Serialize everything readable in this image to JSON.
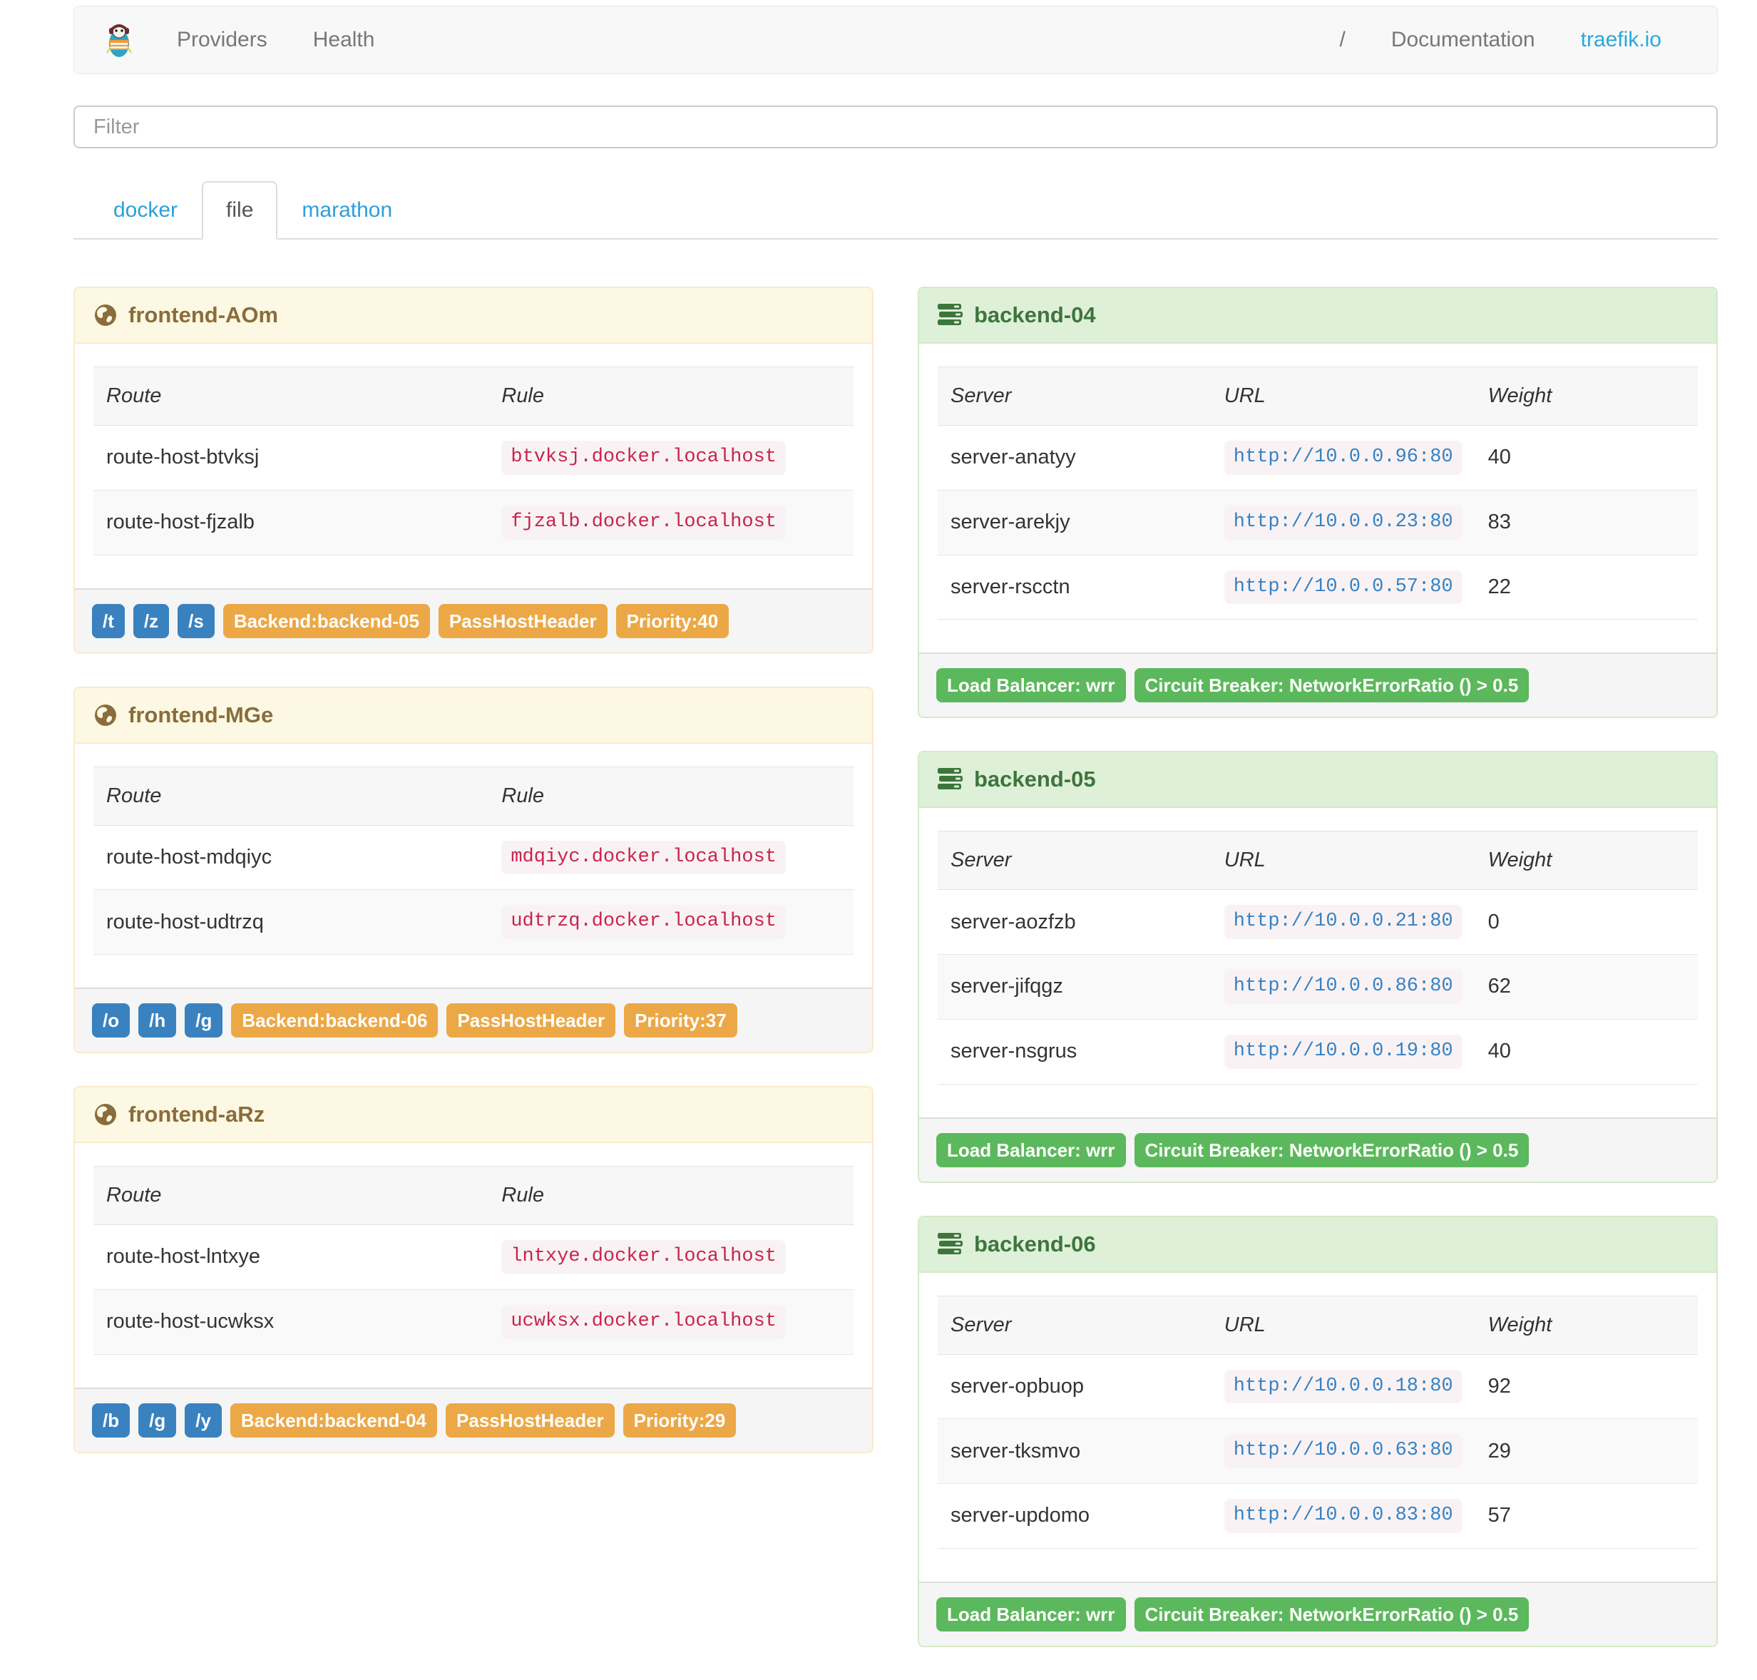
{
  "navbar": {
    "providers": "Providers",
    "health": "Health",
    "separator": "/",
    "documentation": "Documentation",
    "site_link": "traefik.io"
  },
  "filter": {
    "placeholder": "Filter"
  },
  "tabs": {
    "docker": "docker",
    "file": "file",
    "marathon": "marathon"
  },
  "labels": {
    "route": "Route",
    "rule": "Rule",
    "server": "Server",
    "url": "URL",
    "weight": "Weight"
  },
  "frontends": [
    {
      "title": "frontend-AOm",
      "routes": [
        {
          "route": "route-host-btvksj",
          "rule": "btvksj.docker.localhost"
        },
        {
          "route": "route-host-fjzalb",
          "rule": "fjzalb.docker.localhost"
        }
      ],
      "paths": [
        "/t",
        "/z",
        "/s"
      ],
      "backend_badge": "Backend:backend-05",
      "pass_host_header": "PassHostHeader",
      "priority": "Priority:40"
    },
    {
      "title": "frontend-MGe",
      "routes": [
        {
          "route": "route-host-mdqiyc",
          "rule": "mdqiyc.docker.localhost"
        },
        {
          "route": "route-host-udtrzq",
          "rule": "udtrzq.docker.localhost"
        }
      ],
      "paths": [
        "/o",
        "/h",
        "/g"
      ],
      "backend_badge": "Backend:backend-06",
      "pass_host_header": "PassHostHeader",
      "priority": "Priority:37"
    },
    {
      "title": "frontend-aRz",
      "routes": [
        {
          "route": "route-host-lntxye",
          "rule": "lntxye.docker.localhost"
        },
        {
          "route": "route-host-ucwksx",
          "rule": "ucwksx.docker.localhost"
        }
      ],
      "paths": [
        "/b",
        "/g",
        "/y"
      ],
      "backend_badge": "Backend:backend-04",
      "pass_host_header": "PassHostHeader",
      "priority": "Priority:29"
    }
  ],
  "backends": [
    {
      "title": "backend-04",
      "servers": [
        {
          "server": "server-anatyy",
          "url": "http://10.0.0.96:80",
          "weight": "40"
        },
        {
          "server": "server-arekjy",
          "url": "http://10.0.0.23:80",
          "weight": "83"
        },
        {
          "server": "server-rscctn",
          "url": "http://10.0.0.57:80",
          "weight": "22"
        }
      ],
      "load_balancer": "Load Balancer: wrr",
      "circuit_breaker": "Circuit Breaker: NetworkErrorRatio () > 0.5"
    },
    {
      "title": "backend-05",
      "servers": [
        {
          "server": "server-aozfzb",
          "url": "http://10.0.0.21:80",
          "weight": "0"
        },
        {
          "server": "server-jifqgz",
          "url": "http://10.0.0.86:80",
          "weight": "62"
        },
        {
          "server": "server-nsgrus",
          "url": "http://10.0.0.19:80",
          "weight": "40"
        }
      ],
      "load_balancer": "Load Balancer: wrr",
      "circuit_breaker": "Circuit Breaker: NetworkErrorRatio () > 0.5"
    },
    {
      "title": "backend-06",
      "servers": [
        {
          "server": "server-opbuop",
          "url": "http://10.0.0.18:80",
          "weight": "92"
        },
        {
          "server": "server-tksmvo",
          "url": "http://10.0.0.63:80",
          "weight": "29"
        },
        {
          "server": "server-updomo",
          "url": "http://10.0.0.83:80",
          "weight": "57"
        }
      ],
      "load_balancer": "Load Balancer: wrr",
      "circuit_breaker": "Circuit Breaker: NetworkErrorRatio () > 0.5"
    }
  ],
  "colors": {
    "link_blue": "#2d9fd9",
    "site_link_blue": "#29a8dd",
    "badge_blue": "#3982bf",
    "badge_orange": "#eca846",
    "badge_green": "#5cb85c",
    "frontend_title": "#8a6d3b",
    "frontend_header_bg": "#fcf8e3",
    "backend_title": "#3c763d",
    "backend_header_bg": "#dff0d8",
    "code_pink": "#c7254e",
    "code_bg": "#f9f2f4",
    "url_blue": "#3582c4",
    "navbar_bg": "#f8f8f8"
  }
}
